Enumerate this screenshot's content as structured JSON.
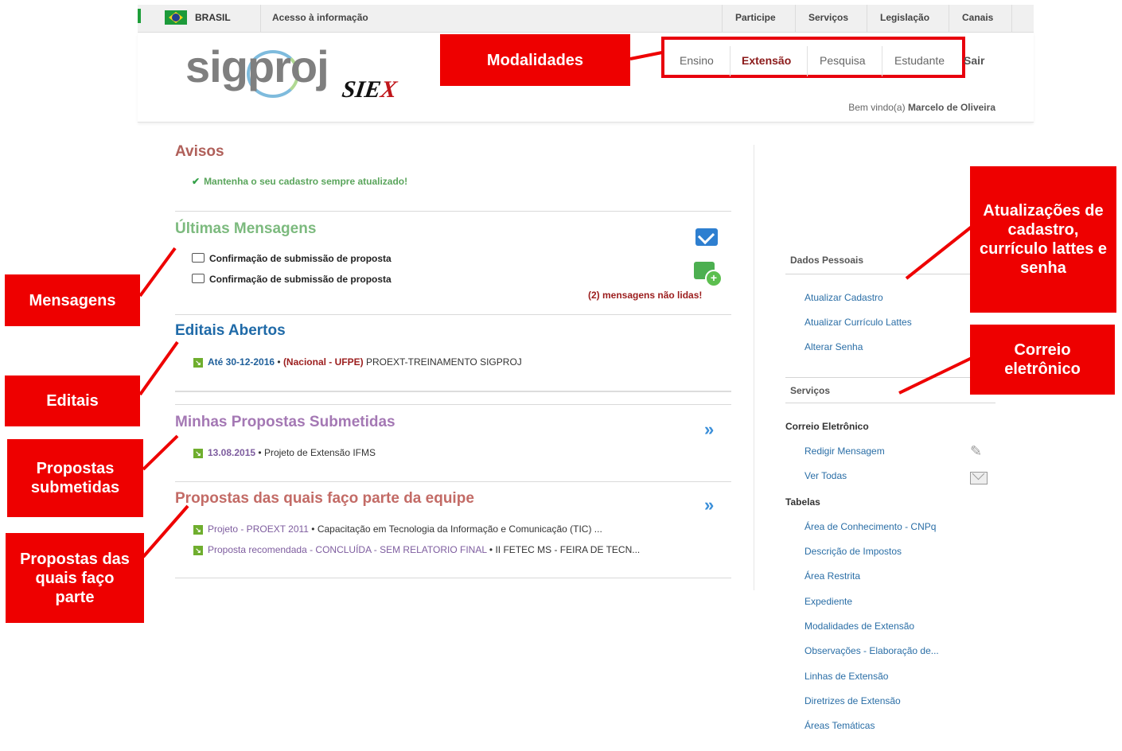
{
  "govbar": {
    "country": "BRASIL",
    "access": "Acesso à informação",
    "links": [
      "Participe",
      "Serviços",
      "Legislação",
      "Canais"
    ]
  },
  "header": {
    "logo": "sigproj",
    "logo2": "SIEX",
    "modalities": [
      "Ensino",
      "Extensão",
      "Pesquisa",
      "Estudante"
    ],
    "active_modality": "Extensão",
    "logout": "Sair",
    "welcome_prefix": "Bem vindo(a)",
    "welcome_user": "Marcelo de Oliveira"
  },
  "avisos": {
    "title": "Avisos",
    "item": "Mantenha o seu cadastro sempre atualizado!"
  },
  "mensagens": {
    "title": "Últimas Mensagens",
    "items": [
      "Confirmação de submissão de proposta",
      "Confirmação de submissão de proposta"
    ],
    "unread": "(2) mensagens não lidas!"
  },
  "editais": {
    "title": "Editais Abertos",
    "item_date": "Até 30-12-2016",
    "item_scope": "(Nacional - UFPE)",
    "item_name": "PROEXT-TREINAMENTO SIGPROJ"
  },
  "propostas": {
    "title": "Minhas Propostas Submetidas",
    "item_date": "13.08.2015",
    "item_name": "Projeto de Extensão IFMS"
  },
  "equipe": {
    "title": "Propostas das quais faço parte da equipe",
    "items": [
      {
        "type": "Projeto - PROEXT 2011",
        "name": "Capacitação em Tecnologia da Informação e Comunicação (TIC) ..."
      },
      {
        "type": "Proposta recomendada - CONCLUÍDA - SEM RELATORIO FINAL",
        "name": "II FETEC MS - FEIRA DE TECN..."
      }
    ]
  },
  "sidebar": {
    "dados_title": "Dados Pessoais",
    "dados_links": [
      "Atualizar Cadastro",
      "Atualizar Currículo Lattes",
      "Alterar Senha"
    ],
    "servicos_title": "Serviços",
    "correio_title": "Correio Eletrônico",
    "correio_links": [
      "Redigir Mensagem",
      "Ver Todas"
    ],
    "tabelas_title": "Tabelas",
    "tabelas_links": [
      "Área de Conhecimento - CNPq",
      "Descrição de Impostos",
      "Área Restrita",
      "Expediente",
      "Modalidades de Extensão",
      "Observações - Elaboração de...",
      "Linhas de Extensão",
      "Diretrizes de Extensão",
      "Áreas Temáticas"
    ]
  },
  "annotations": {
    "modalidades": "Modalidades",
    "mensagens": "Mensagens",
    "editais": "Editais",
    "propostas": "Propostas submetidas",
    "equipe": "Propostas das quais faço parte",
    "atualizacoes": "Atualizações de cadastro, currículo lattes e senha",
    "correio": "Correio eletrônico"
  },
  "colors": {
    "accent": "#ee0000",
    "link": "#2a6ea6",
    "active": "#8b1a1a"
  }
}
